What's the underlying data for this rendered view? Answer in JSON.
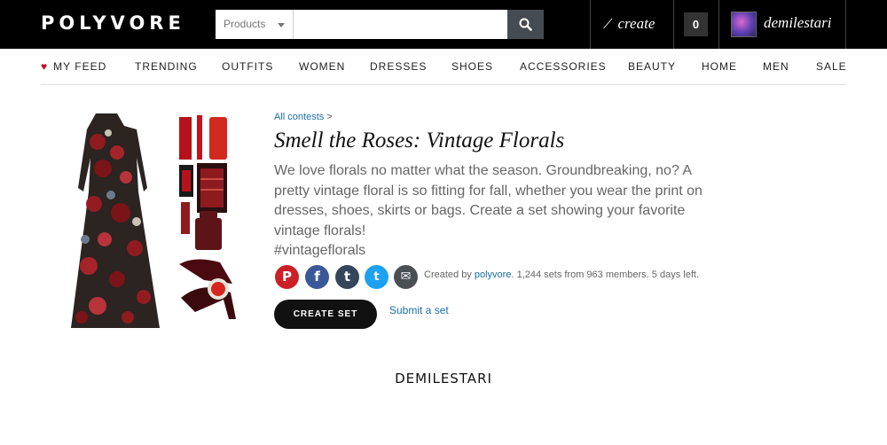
{
  "header": {
    "logo": "POLYVORE",
    "search": {
      "category": "Products",
      "placeholder": "",
      "value": ""
    },
    "create_label": "create",
    "cart_count": "0",
    "username": "demilestari"
  },
  "nav": {
    "items": [
      {
        "label": "MY FEED",
        "has_heart": true
      },
      {
        "label": "TRENDING"
      },
      {
        "label": "OUTFITS"
      },
      {
        "label": "WOMEN"
      },
      {
        "label": "DRESSES"
      },
      {
        "label": "SHOES"
      },
      {
        "label": "ACCESSORIES"
      },
      {
        "label": "BEAUTY"
      },
      {
        "label": "HOME"
      },
      {
        "label": "MEN"
      },
      {
        "label": "SALE"
      }
    ]
  },
  "contest": {
    "breadcrumb_link": "All contests",
    "breadcrumb_sep": ">",
    "title": "Smell the Roses: Vintage Florals",
    "description": "We love florals no matter what the season. Groundbreaking, no? A pretty vintage floral is so fitting for fall, whether you wear the print on dresses, shoes, skirts or bags. Create a set showing your favorite vintage florals!",
    "hashtag": "#vintageflorals",
    "meta_prefix": "Created by",
    "meta_author": "polyvore",
    "meta_suffix": ". 1,244 sets from 963 members. 5 days left.",
    "create_set_label": "CREATE SET",
    "submit_set_label": "Submit a set"
  },
  "social": [
    {
      "name": "pinterest",
      "glyph": "P",
      "color": "#cb2027"
    },
    {
      "name": "facebook",
      "glyph": "f",
      "color": "#3b5998"
    },
    {
      "name": "tumblr",
      "glyph": "t",
      "color": "#35465c"
    },
    {
      "name": "twitter",
      "glyph": "t",
      "color": "#1da1f2"
    },
    {
      "name": "email",
      "glyph": "✉",
      "color": "#4a4f54"
    }
  ],
  "footer_name": "DEMILESTARI"
}
